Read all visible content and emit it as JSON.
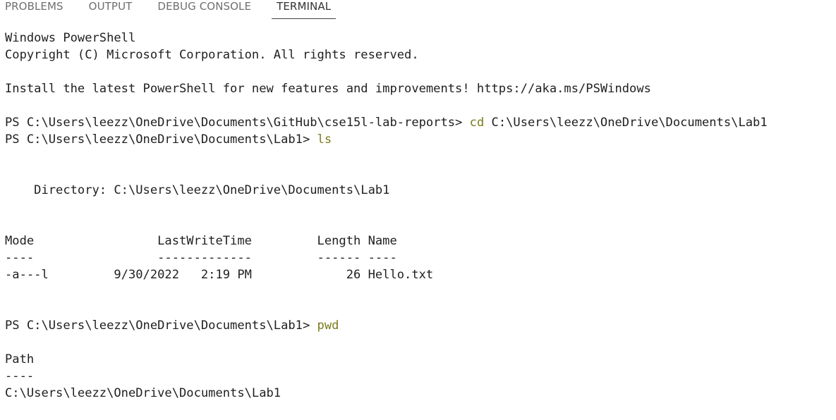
{
  "panel": {
    "tabs": [
      {
        "label": "PROBLEMS",
        "active": false
      },
      {
        "label": "OUTPUT",
        "active": false
      },
      {
        "label": "DEBUG CONSOLE",
        "active": false
      },
      {
        "label": "TERMINAL",
        "active": true
      }
    ]
  },
  "colors": {
    "command": "#7b7b1f",
    "text": "#1f1f1f",
    "inactive_tab": "#6f6f6f",
    "active_tab_underline": "#424242"
  },
  "terminal": {
    "lines": [
      {
        "text": "Windows PowerShell"
      },
      {
        "text": "Copyright (C) Microsoft Corporation. All rights reserved."
      },
      {
        "text": ""
      },
      {
        "text": "Install the latest PowerShell for new features and improvements! https://aka.ms/PSWindows"
      },
      {
        "text": ""
      },
      {
        "prompt": "PS C:\\Users\\leezz\\OneDrive\\Documents\\GitHub\\cse15l-lab-reports> ",
        "cmd": "cd",
        "rest": " C:\\Users\\leezz\\OneDrive\\Documents\\Lab1"
      },
      {
        "prompt": "PS C:\\Users\\leezz\\OneDrive\\Documents\\Lab1> ",
        "cmd": "ls",
        "rest": ""
      },
      {
        "text": ""
      },
      {
        "text": ""
      },
      {
        "text": "    Directory: C:\\Users\\leezz\\OneDrive\\Documents\\Lab1"
      },
      {
        "text": ""
      },
      {
        "text": ""
      },
      {
        "text": "Mode                 LastWriteTime         Length Name"
      },
      {
        "text": "----                 -------------         ------ ----"
      },
      {
        "text": "-a---l         9/30/2022   2:19 PM             26 Hello.txt"
      },
      {
        "text": ""
      },
      {
        "text": ""
      },
      {
        "prompt": "PS C:\\Users\\leezz\\OneDrive\\Documents\\Lab1> ",
        "cmd": "pwd",
        "rest": ""
      },
      {
        "text": ""
      },
      {
        "text": "Path"
      },
      {
        "text": "----"
      },
      {
        "text": "C:\\Users\\leezz\\OneDrive\\Documents\\Lab1"
      }
    ]
  }
}
